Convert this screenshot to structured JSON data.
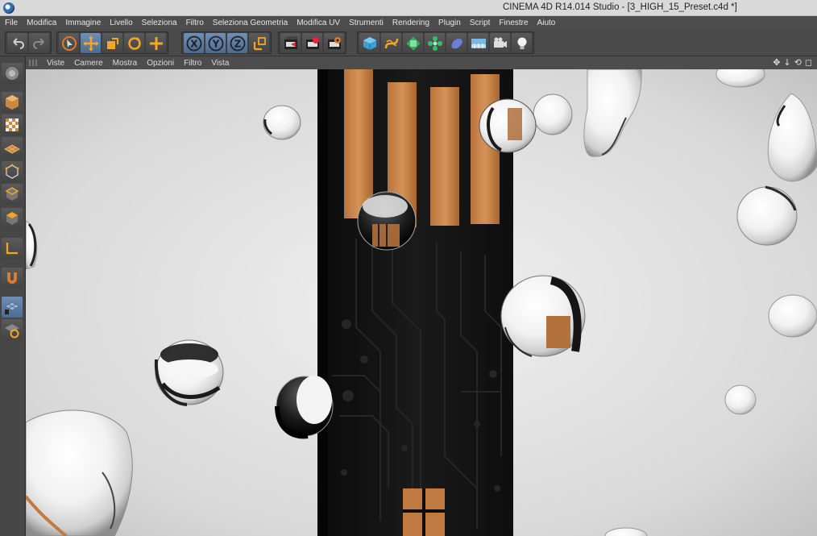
{
  "window": {
    "title": "CINEMA 4D R14.014 Studio - [3_HIGH_15_Preset.c4d *]"
  },
  "menubar": {
    "items": [
      "File",
      "Modifica",
      "Immagine",
      "Livello",
      "Seleziona",
      "Filtro",
      "Seleziona Geometria",
      "Modifica UV",
      "Strumenti",
      "Rendering",
      "Plugin",
      "Script",
      "Finestre",
      "Aiuto"
    ]
  },
  "toolbar": {
    "icons": [
      "undo-icon",
      "redo-icon",
      "live-selection-icon",
      "move-icon",
      "scale-icon",
      "rotate-icon",
      "add-icon",
      "x-axis-lock-icon",
      "y-axis-lock-icon",
      "z-axis-lock-icon",
      "coordinate-system-icon",
      "render-view-icon",
      "render-picture-viewer-icon",
      "render-settings-icon",
      "cube-primitive-icon",
      "spline-icon",
      "nurbs-icon",
      "array-icon",
      "deformer-icon",
      "environment-icon",
      "camera-icon",
      "light-icon"
    ],
    "x_label": "X",
    "y_label": "Y",
    "z_label": "Z"
  },
  "left_palette": {
    "icons": [
      "make-editable-icon",
      "model-mode-icon",
      "texture-mode-icon",
      "workplane-icon",
      "points-mode-icon",
      "edges-mode-icon",
      "polygons-mode-icon",
      "axis-mode-icon",
      "magnet-icon",
      "snap-icon",
      "workplane-lock-icon"
    ]
  },
  "viewport": {
    "menu": [
      "Viste",
      "Camere",
      "Mostra",
      "Opzioni",
      "Filtro",
      "Vista"
    ],
    "nav_glyphs": [
      "✥",
      "↓",
      "⟲",
      "◻"
    ],
    "colors": {
      "background": "#e2e2e2",
      "pcb": "#141414",
      "copper": "#c27b45"
    }
  }
}
